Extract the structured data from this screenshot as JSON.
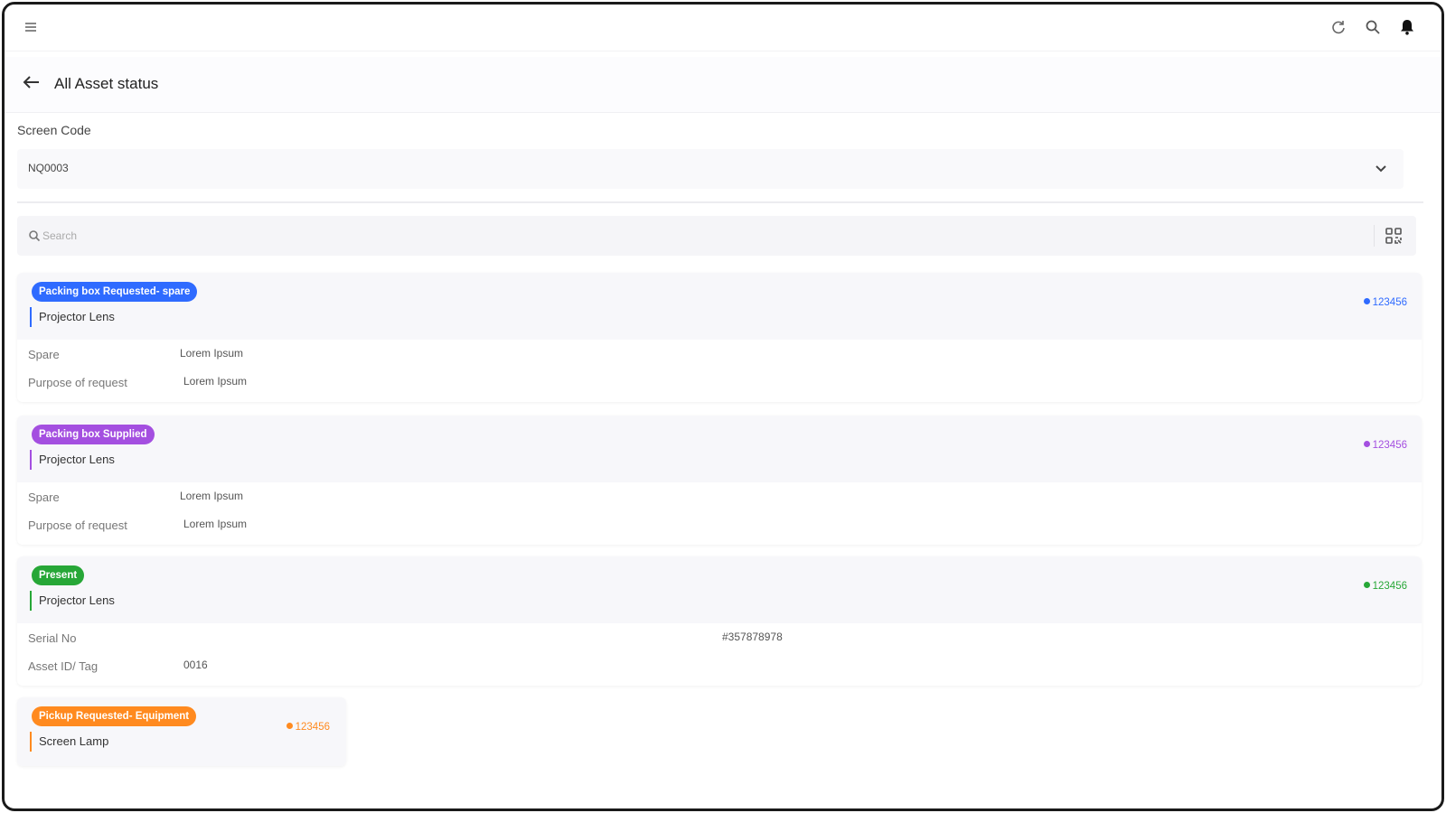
{
  "header": {
    "title": "All Asset status"
  },
  "screen_code": {
    "label": "Screen Code",
    "value": "NQ0003"
  },
  "search": {
    "placeholder": "Search"
  },
  "icons": {
    "menu": "menu-icon",
    "refresh": "refresh-icon",
    "search": "search-icon",
    "notifications": "bell-icon",
    "back": "back-arrow-icon",
    "dropdown": "chevron-down-icon",
    "qr": "qr-code-icon"
  },
  "colors": {
    "blue": "#2f6bff",
    "purple": "#a44fe0",
    "green": "#27a737",
    "orange": "#ff8a1f"
  },
  "cards": [
    {
      "status": "Packing box Requested- spare",
      "asset": "Projector Lens",
      "ref": "123456",
      "rows": [
        {
          "label": "Spare",
          "value": "Lorem Ipsum"
        },
        {
          "label": "Purpose of request",
          "value": "Lorem Ipsum"
        }
      ]
    },
    {
      "status": "Packing box Supplied",
      "asset": "Projector Lens",
      "ref": "123456",
      "rows": [
        {
          "label": "Spare",
          "value": "Lorem Ipsum"
        },
        {
          "label": "Purpose of request",
          "value": "Lorem Ipsum"
        }
      ]
    },
    {
      "status": "Present",
      "asset": "Projector Lens",
      "ref": "123456",
      "rows": [
        {
          "label": "Serial No",
          "value": "#357878978"
        },
        {
          "label": "Asset ID/ Tag",
          "value": "0016"
        }
      ]
    },
    {
      "status": "Pickup Requested- Equipment",
      "asset": "Screen Lamp",
      "ref": "123456",
      "rows": []
    }
  ]
}
